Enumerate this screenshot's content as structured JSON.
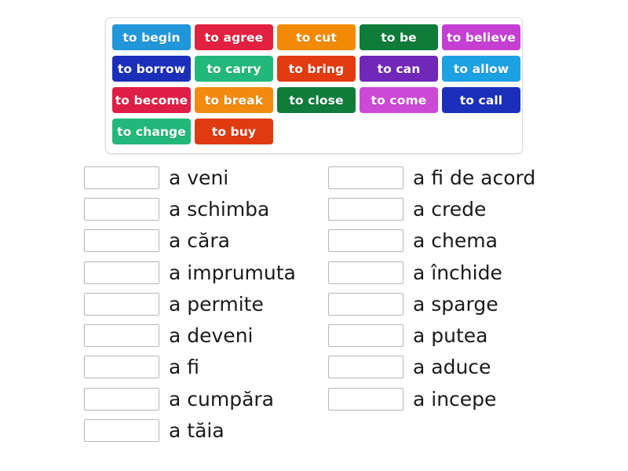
{
  "activity": {
    "type": "match-up",
    "tile_bank_label": "Draggable answer tiles"
  },
  "tile_bank": {
    "rows": [
      [
        {
          "label": "to begin",
          "color": "#2196d9"
        },
        {
          "label": "to agree",
          "color": "#e1213f"
        },
        {
          "label": "to cut",
          "color": "#f28a06"
        },
        {
          "label": "to be",
          "color": "#0f7c3a"
        },
        {
          "label": "to believe",
          "color": "#c540d2"
        }
      ],
      [
        {
          "label": "to borrow",
          "color": "#1c2fba"
        },
        {
          "label": "to carry",
          "color": "#22b87a"
        },
        {
          "label": "to bring",
          "color": "#e23b11"
        },
        {
          "label": "to can",
          "color": "#7127b9"
        },
        {
          "label": "to allow",
          "color": "#1ca2e2"
        }
      ],
      [
        {
          "label": "to become",
          "color": "#e01e45"
        },
        {
          "label": "to break",
          "color": "#f28a0f"
        },
        {
          "label": "to close",
          "color": "#0f7c3a"
        },
        {
          "label": "to come",
          "color": "#cc49d6"
        },
        {
          "label": "to call",
          "color": "#1c2fba"
        }
      ],
      [
        {
          "label": "to change",
          "color": "#22b87a"
        },
        {
          "label": "to buy",
          "color": "#e03a11"
        }
      ]
    ]
  },
  "answers": {
    "left_column": [
      {
        "label": "a veni",
        "slot_value": ""
      },
      {
        "label": "a schimba",
        "slot_value": ""
      },
      {
        "label": "a căra",
        "slot_value": ""
      },
      {
        "label": "a imprumuta",
        "slot_value": ""
      },
      {
        "label": "a permite",
        "slot_value": ""
      },
      {
        "label": "a deveni",
        "slot_value": ""
      },
      {
        "label": "a fi",
        "slot_value": ""
      },
      {
        "label": "a cumpăra",
        "slot_value": ""
      },
      {
        "label": "a tăia",
        "slot_value": ""
      }
    ],
    "right_column": [
      {
        "label": "a fi de acord",
        "slot_value": ""
      },
      {
        "label": "a crede",
        "slot_value": ""
      },
      {
        "label": "a chema",
        "slot_value": ""
      },
      {
        "label": "a închide",
        "slot_value": ""
      },
      {
        "label": "a sparge",
        "slot_value": ""
      },
      {
        "label": "a putea",
        "slot_value": ""
      },
      {
        "label": "a aduce",
        "slot_value": ""
      },
      {
        "label": "a incepe",
        "slot_value": ""
      }
    ]
  }
}
